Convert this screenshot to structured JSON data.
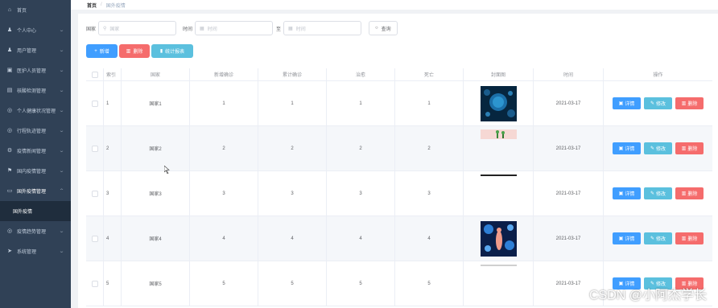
{
  "sidebar": {
    "items": [
      {
        "label": "首页",
        "icon": "home-icon",
        "glyph": "⌂",
        "chevron": false
      },
      {
        "label": "个人中心",
        "icon": "user-icon",
        "glyph": "♟",
        "chevron": true
      },
      {
        "label": "用户管理",
        "icon": "user-icon",
        "glyph": "♟",
        "chevron": true
      },
      {
        "label": "医护人员管理",
        "icon": "folder-icon",
        "glyph": "▣",
        "chevron": true
      },
      {
        "label": "核酸检测管理",
        "icon": "document-icon",
        "glyph": "▤",
        "chevron": true
      },
      {
        "label": "个人健康状况管理",
        "icon": "circle-icon",
        "glyph": "◎",
        "chevron": true
      },
      {
        "label": "行程轨迹管理",
        "icon": "circle-icon",
        "glyph": "◎",
        "chevron": true
      },
      {
        "label": "疫情新闻管理",
        "icon": "gear-icon",
        "glyph": "⚙",
        "chevron": true
      },
      {
        "label": "国内疫情管理",
        "icon": "flag-icon",
        "glyph": "⚑",
        "chevron": true
      },
      {
        "label": "国外疫情管理",
        "icon": "table-icon",
        "glyph": "▭",
        "chevron": true,
        "open": true
      },
      {
        "label": "国外疫情",
        "sub": true
      },
      {
        "label": "疫情趋势管理",
        "icon": "circle-icon",
        "glyph": "◎",
        "chevron": true
      },
      {
        "label": "系统管理",
        "icon": "send-icon",
        "glyph": "➤",
        "chevron": true
      }
    ]
  },
  "breadcrumb": {
    "home": "首页",
    "sep": "/",
    "current": "国外疫情"
  },
  "search": {
    "country_label": "国家",
    "country_placeholder": "国家",
    "time_label": "时间",
    "time_from_placeholder": "时间",
    "to_label": "至",
    "time_to_placeholder": "时间",
    "search_button": "查询"
  },
  "actions": {
    "add": "新增",
    "delete": "删除",
    "report": "统计报表"
  },
  "table": {
    "headers": [
      "索引",
      "国家",
      "新增确诊",
      "累计确诊",
      "治愈",
      "死亡",
      "封面图",
      "时间",
      "操作"
    ],
    "rows": [
      {
        "index": "1",
        "country": "国家1",
        "new_confirmed": "1",
        "total_confirmed": "1",
        "cured": "1",
        "deaths": "1",
        "image": "virus-blue",
        "time": "2021-03-17"
      },
      {
        "index": "2",
        "country": "国家2",
        "new_confirmed": "2",
        "total_confirmed": "2",
        "cured": "2",
        "deaths": "2",
        "image": "plants",
        "time": "2021-03-17"
      },
      {
        "index": "3",
        "country": "国家3",
        "new_confirmed": "3",
        "total_confirmed": "3",
        "cured": "3",
        "deaths": "3",
        "image": "dark-strip",
        "time": "2021-03-17"
      },
      {
        "index": "4",
        "country": "国家4",
        "new_confirmed": "4",
        "total_confirmed": "4",
        "cured": "4",
        "deaths": "4",
        "image": "virus-figure",
        "time": "2021-03-17"
      },
      {
        "index": "5",
        "country": "国家5",
        "new_confirmed": "5",
        "total_confirmed": "5",
        "cured": "5",
        "deaths": "5",
        "image": "light-strip",
        "time": "2021-03-17"
      }
    ],
    "op_labels": {
      "detail": "详情",
      "edit": "修改",
      "remove": "删除"
    }
  },
  "watermark": "CSDN @小阿杰学长",
  "colors": {
    "sidebar_bg": "#304156",
    "primary": "#409eff",
    "danger": "#f56c6c",
    "info": "#5bc0de"
  }
}
